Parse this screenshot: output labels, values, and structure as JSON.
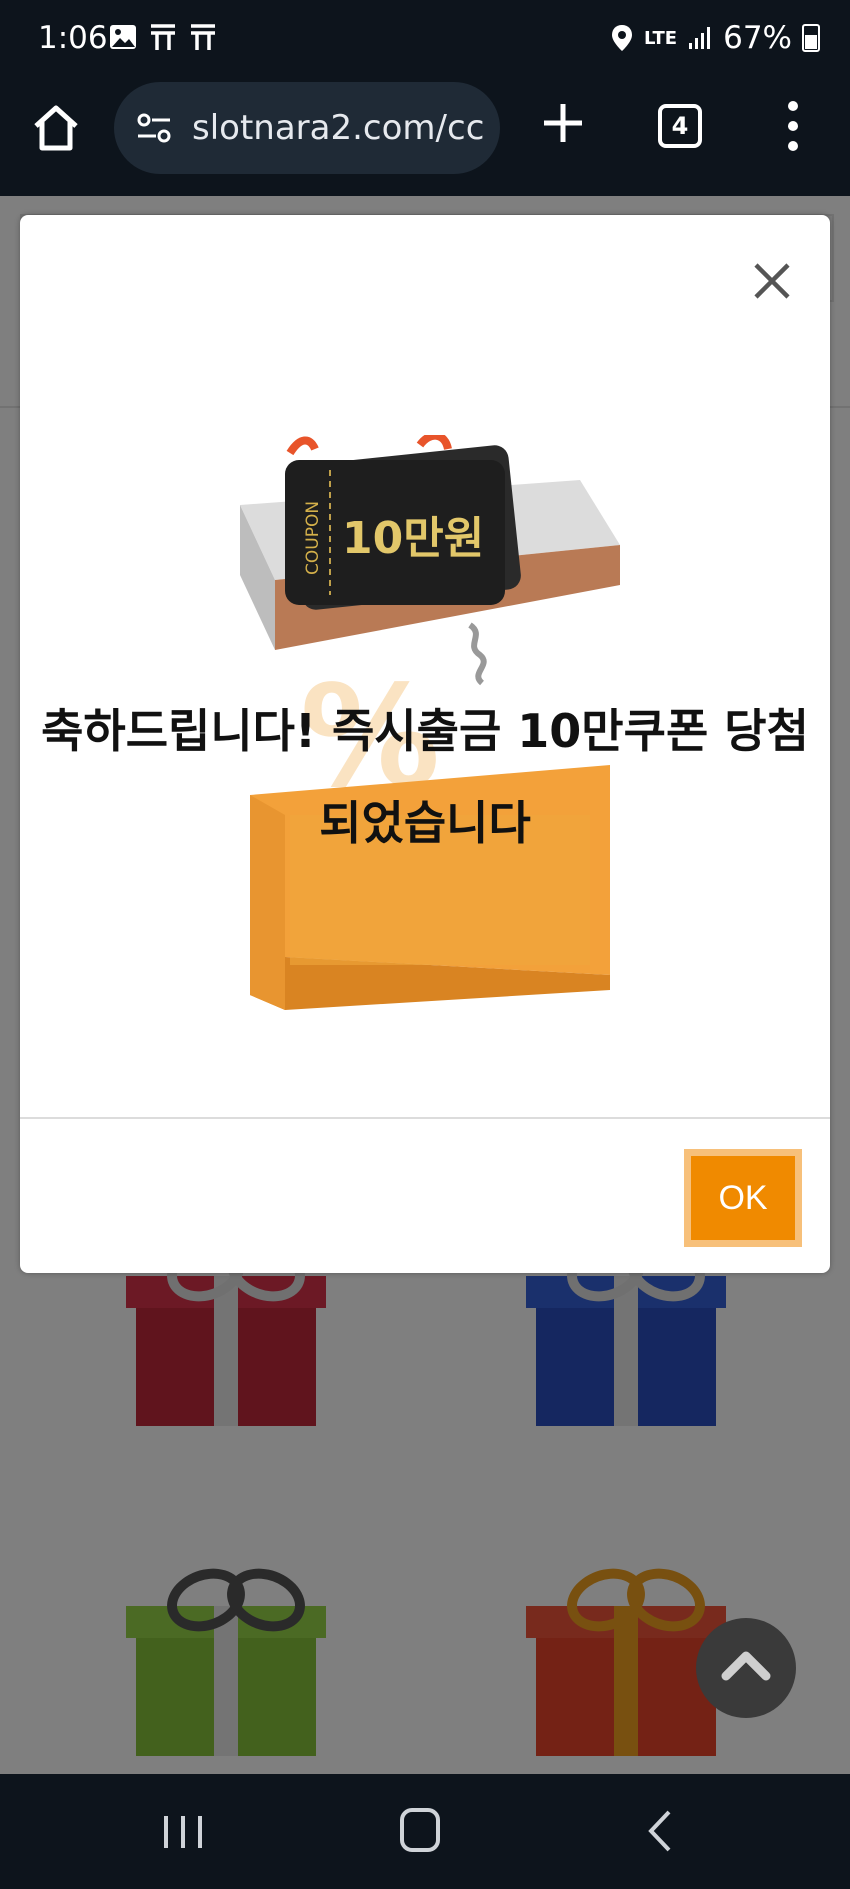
{
  "status_bar": {
    "time": "1:06",
    "left_icons": [
      "image-icon",
      "t-icon",
      "t-icon"
    ],
    "network": "LTE",
    "battery": "67%"
  },
  "browser": {
    "url": "slotnara2.com/cc",
    "tab_count": "4"
  },
  "dialog": {
    "message": "축하드립니다! 즉시출금 10만쿠폰 당첨 되었습니다",
    "coupon_label": "COUPON",
    "coupon_value": "10만원",
    "ok_label": "OK"
  },
  "colors": {
    "accent": "#f08a00",
    "chrome_bg": "#0d141c"
  }
}
